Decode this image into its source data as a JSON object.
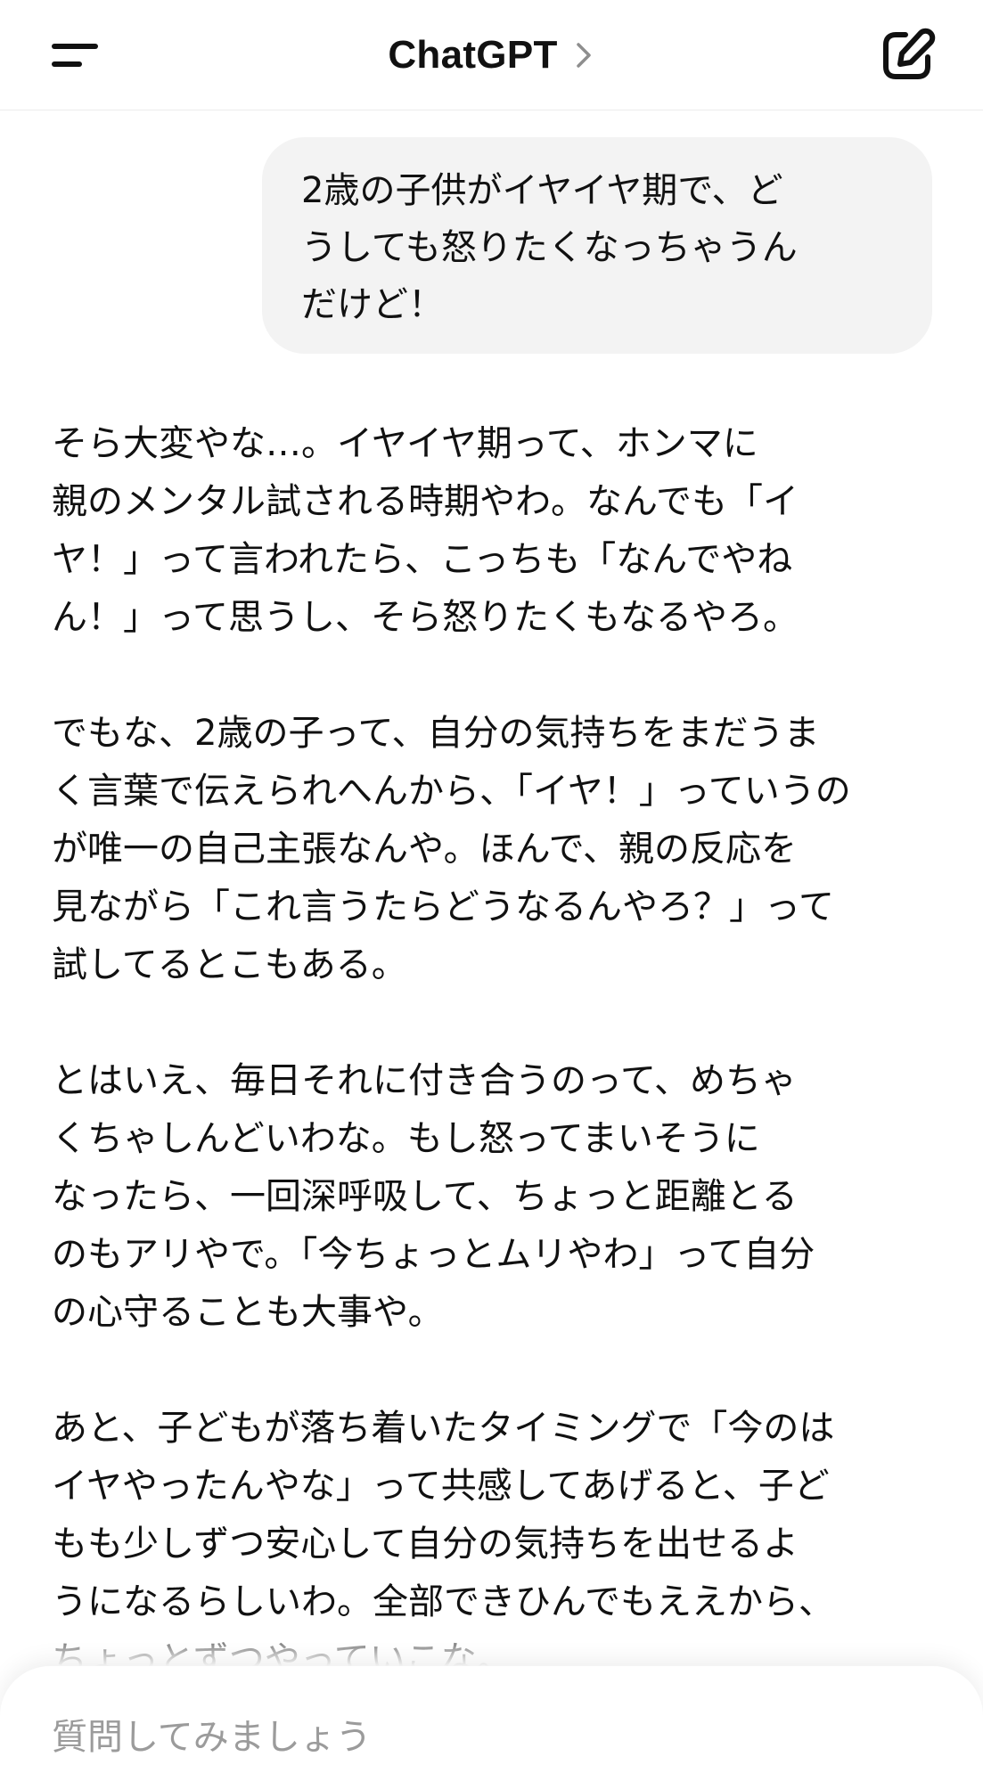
{
  "header": {
    "title": "ChatGPT",
    "menu_icon": "hamburger-menu-icon",
    "chevron_icon": "chevron-right-icon",
    "new_chat_icon": "new-chat-edit-icon"
  },
  "conversation": {
    "user_message": "2歳の子供がイヤイヤ期で、ど\nうしても怒りたくなっちゃうん\nだけど！",
    "assistant_paragraphs": [
      "そら大変やな…。イヤイヤ期って、ホンマに\n親のメンタル試される時期やわ。なんでも「イ\nヤ！」って言われたら、こっちも「なんでやね\nん！」って思うし、そら怒りたくもなるやろ。",
      "でもな、2歳の子って、自分の気持ちをまだうま\nく言葉で伝えられへんから、「イヤ！」っていうの\nが唯一の自己主張なんや。ほんで、親の反応を\n見ながら「これ言うたらどうなるんやろ？」って\n試してるとこもある。",
      "とはいえ、毎日それに付き合うのって、めちゃ\nくちゃしんどいわな。もし怒ってまいそうに\nなったら、一回深呼吸して、ちょっと距離とる\nのもアリやで。「今ちょっとムリやわ」って自分\nの心守ることも大事や。",
      "あと、子どもが落ち着いたタイミングで「今のは\nイヤやったんやな」って共感してあげると、子ど\nもも少しずつ安心して自分の気持ちを出せるよ\nうになるらしいわ。全部できひんでもええから、\nちょっとずつやっていこな。"
    ]
  },
  "composer": {
    "placeholder": "質問してみましょう",
    "value": ""
  }
}
